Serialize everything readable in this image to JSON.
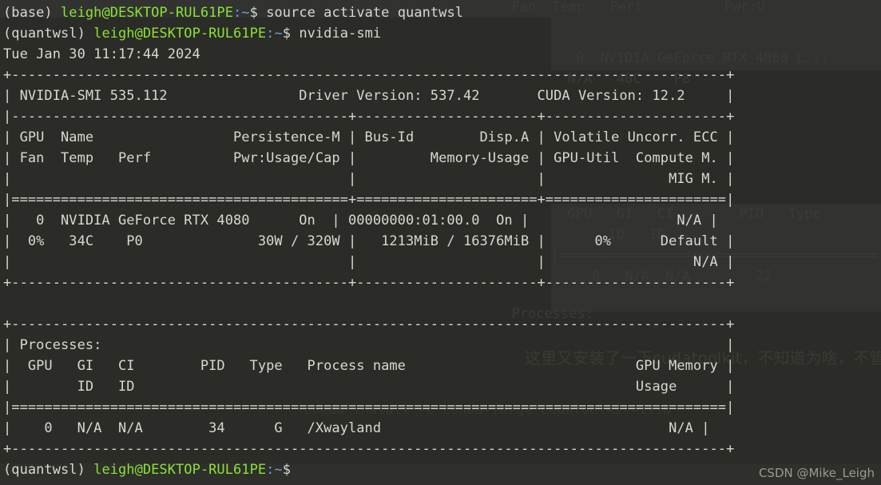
{
  "terminal": {
    "background_color": "#2b2b28",
    "foreground_color": "#d8d8d2",
    "prompt_user_color": "#8ae234",
    "prompt_path_color": "#6a9fd4"
  },
  "prompt": {
    "env_base": "(base)",
    "env_quantwsl": "(quantwsl)",
    "userhost": "leigh@DESKTOP-RUL61PE",
    "colon": ":",
    "path": "~",
    "dollar": "$"
  },
  "commands": {
    "first": "source activate quantwsl",
    "second": "nvidia-smi"
  },
  "nvidia_smi": {
    "datestamp": "Tue Jan 30 11:17:44 2024",
    "border_top": "+---------------------------------------------------------------------------------------+",
    "header_line": "| NVIDIA-SMI 535.112                Driver Version: 537.42       CUDA Version: 12.2     |",
    "header_rule": "|-----------------------------------------+----------------------+----------------------+",
    "col_line_1": "| GPU  Name                 Persistence-M | Bus-Id        Disp.A | Volatile Uncorr. ECC |",
    "col_line_2": "| Fan  Temp   Perf          Pwr:Usage/Cap |         Memory-Usage | GPU-Util  Compute M. |",
    "col_line_3": "|                                         |                      |               MIG M. |",
    "col_rule": "|=========================================+======================+======================|",
    "gpu_line_1": "|   0  NVIDIA GeForce RTX 4080      On  | 00000000:01:00.0  On |                  N/A |",
    "gpu_line_2": "|  0%   34C    P0              30W / 320W |   1213MiB / 16376MiB |      0%      Default |",
    "gpu_line_3": "|                                         |                      |                  N/A |",
    "gpu_rule": "+-----------------------------------------+----------------------+----------------------+",
    "proc_border_top": "+---------------------------------------------------------------------------------------+",
    "proc_title": "| Processes:                                                                            |",
    "proc_head_1": "|  GPU   GI   CI        PID   Type   Process name                            GPU Memory |",
    "proc_head_2": "|        ID   ID                                                             Usage      |",
    "proc_rule": "|=======================================================================================|",
    "proc_row_1": "|    0   N/A  N/A        34      G   /Xwayland                                   N/A |",
    "proc_border_bottom": "+---------------------------------------------------------------------------------------+",
    "fields": {
      "smi_version": "535.112",
      "driver_version": "537.42",
      "cuda_version": "12.2",
      "gpu_index": "0",
      "gpu_name": "NVIDIA GeForce RTX 4080",
      "persistence_m": "On",
      "bus_id": "00000000:01:00.0",
      "disp_a": "On",
      "ecc": "N/A",
      "fan": "0%",
      "temp": "34C",
      "perf": "P0",
      "power": "30W / 320W",
      "memory_usage": "1213MiB / 16376MiB",
      "gpu_util": "0%",
      "compute_m": "Default",
      "mig_m": "N/A",
      "process": {
        "gpu": "0",
        "gi_id": "N/A",
        "ci_id": "N/A",
        "pid": "34",
        "type": "G",
        "name": "/Xwayland",
        "gpu_memory_usage": "N/A"
      }
    }
  },
  "ghost": {
    "line_a": "  Fan  Temp   Perf          Pwr:U",
    "line_b": "   0  NVIDIA GeForce RTX 4060 L...",
    "line_c": "  N/A   40C    P8",
    "line_d": "|=======================================",
    "line_e": "     0   N/A  N/A        22",
    "line_f": "  Processes:",
    "line_g": "  GPU   GI   CI        PID   Type",
    "line_h": "       ID   ID",
    "chinese_note": "这里又安装了一下cudatoolkit，不知道为啥，不管了",
    "conda_cmd": "conda install -c conda-forge cudatoolkit=11.8"
  },
  "watermark": {
    "text": "CSDN @Mike_Leigh"
  }
}
